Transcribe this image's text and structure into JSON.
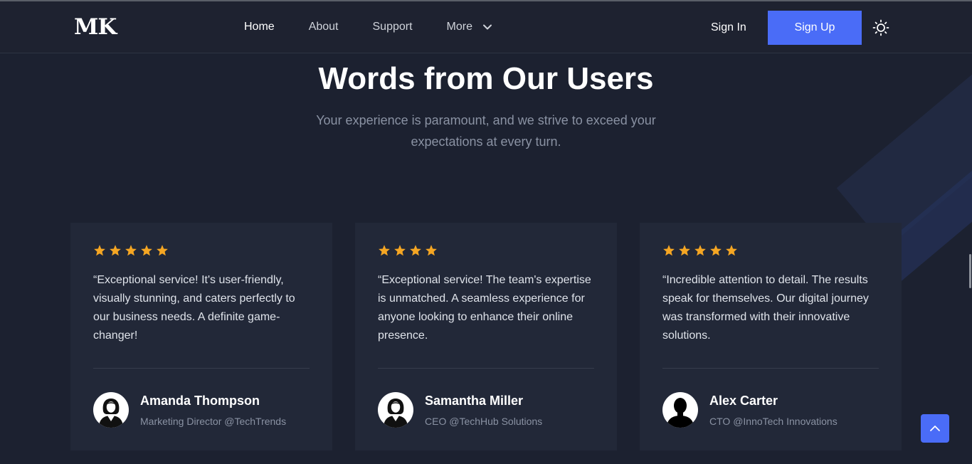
{
  "header": {
    "logo": "MK",
    "nav": [
      "Home",
      "About",
      "Support",
      "More"
    ],
    "sign_in": "Sign In",
    "sign_up": "Sign Up"
  },
  "section": {
    "title": "Words from Our Users",
    "subtitle": "Your experience is paramount, and we strive to exceed your expectations at every turn."
  },
  "testimonials": [
    {
      "rating": 5,
      "quote": "“Exceptional service! It's user-friendly, visually stunning, and caters perfectly to our business needs. A definite game-changer!",
      "name": "Amanda Thompson",
      "role": "Marketing Director @TechTrends",
      "avatar": "female-avatar-icon"
    },
    {
      "rating": 4,
      "quote": "“Exceptional service! The team's expertise is unmatched. A seamless experience for anyone looking to enhance their online presence.",
      "name": "Samantha Miller",
      "role": "CEO @TechHub Solutions",
      "avatar": "female-avatar-icon"
    },
    {
      "rating": 5,
      "quote": "“Incredible attention to detail. The results speak for themselves. Our digital journey was transformed with their innovative solutions.",
      "name": "Alex Carter",
      "role": "CTO @InnoTech Innovations",
      "avatar": "male-avatar-icon"
    }
  ],
  "colors": {
    "background": "#1c2130",
    "card": "#222838",
    "accent": "#4a6cf7",
    "star": "#f5a623"
  },
  "icons": [
    "chevron-down-icon",
    "sun-icon",
    "star-icon",
    "arrow-up-icon"
  ]
}
